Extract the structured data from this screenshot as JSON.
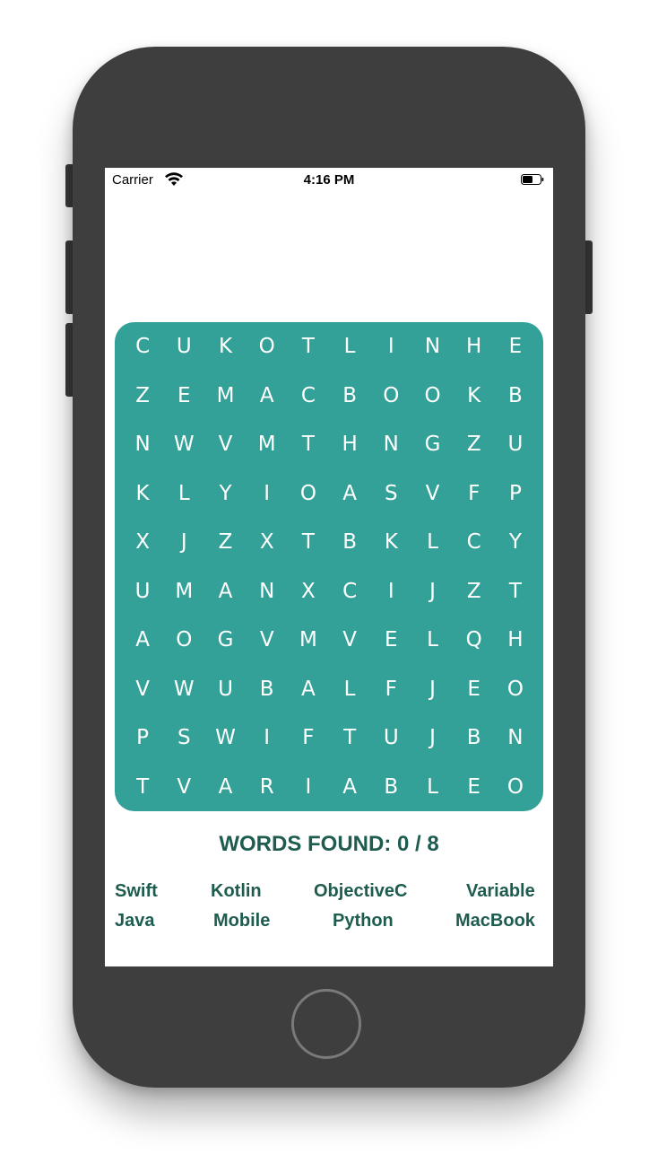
{
  "status_bar": {
    "carrier": "Carrier",
    "time": "4:16 PM",
    "wifi_icon": "wifi-icon",
    "battery_icon": "battery-icon"
  },
  "grid": {
    "background_color": "#33a197",
    "rows": [
      [
        "C",
        "U",
        "K",
        "O",
        "T",
        "L",
        "I",
        "N",
        "H",
        "E"
      ],
      [
        "Z",
        "E",
        "M",
        "A",
        "C",
        "B",
        "O",
        "O",
        "K",
        "B"
      ],
      [
        "N",
        "W",
        "V",
        "M",
        "T",
        "H",
        "N",
        "G",
        "Z",
        "U"
      ],
      [
        "K",
        "L",
        "Y",
        "I",
        "O",
        "A",
        "S",
        "V",
        "F",
        "P"
      ],
      [
        "X",
        "J",
        "Z",
        "X",
        "T",
        "B",
        "K",
        "L",
        "C",
        "Y"
      ],
      [
        "U",
        "M",
        "A",
        "N",
        "X",
        "C",
        "I",
        "J",
        "Z",
        "T"
      ],
      [
        "A",
        "O",
        "G",
        "V",
        "M",
        "V",
        "E",
        "L",
        "Q",
        "H"
      ],
      [
        "V",
        "W",
        "U",
        "B",
        "A",
        "L",
        "F",
        "J",
        "E",
        "O"
      ],
      [
        "P",
        "S",
        "W",
        "I",
        "F",
        "T",
        "U",
        "J",
        "B",
        "N"
      ],
      [
        "T",
        "V",
        "A",
        "R",
        "I",
        "A",
        "B",
        "L",
        "E",
        "O"
      ]
    ]
  },
  "progress": {
    "label": "WORDS FOUND: 0 / 8",
    "found": 0,
    "total": 8
  },
  "words": [
    "Swift",
    "Kotlin",
    "ObjectiveC",
    "Variable",
    "Java",
    "Mobile",
    "Python",
    "MacBook"
  ],
  "colors": {
    "accent": "#33a197",
    "text_dark_green": "#1d5c4f",
    "phone_body": "#3e3e3e"
  }
}
